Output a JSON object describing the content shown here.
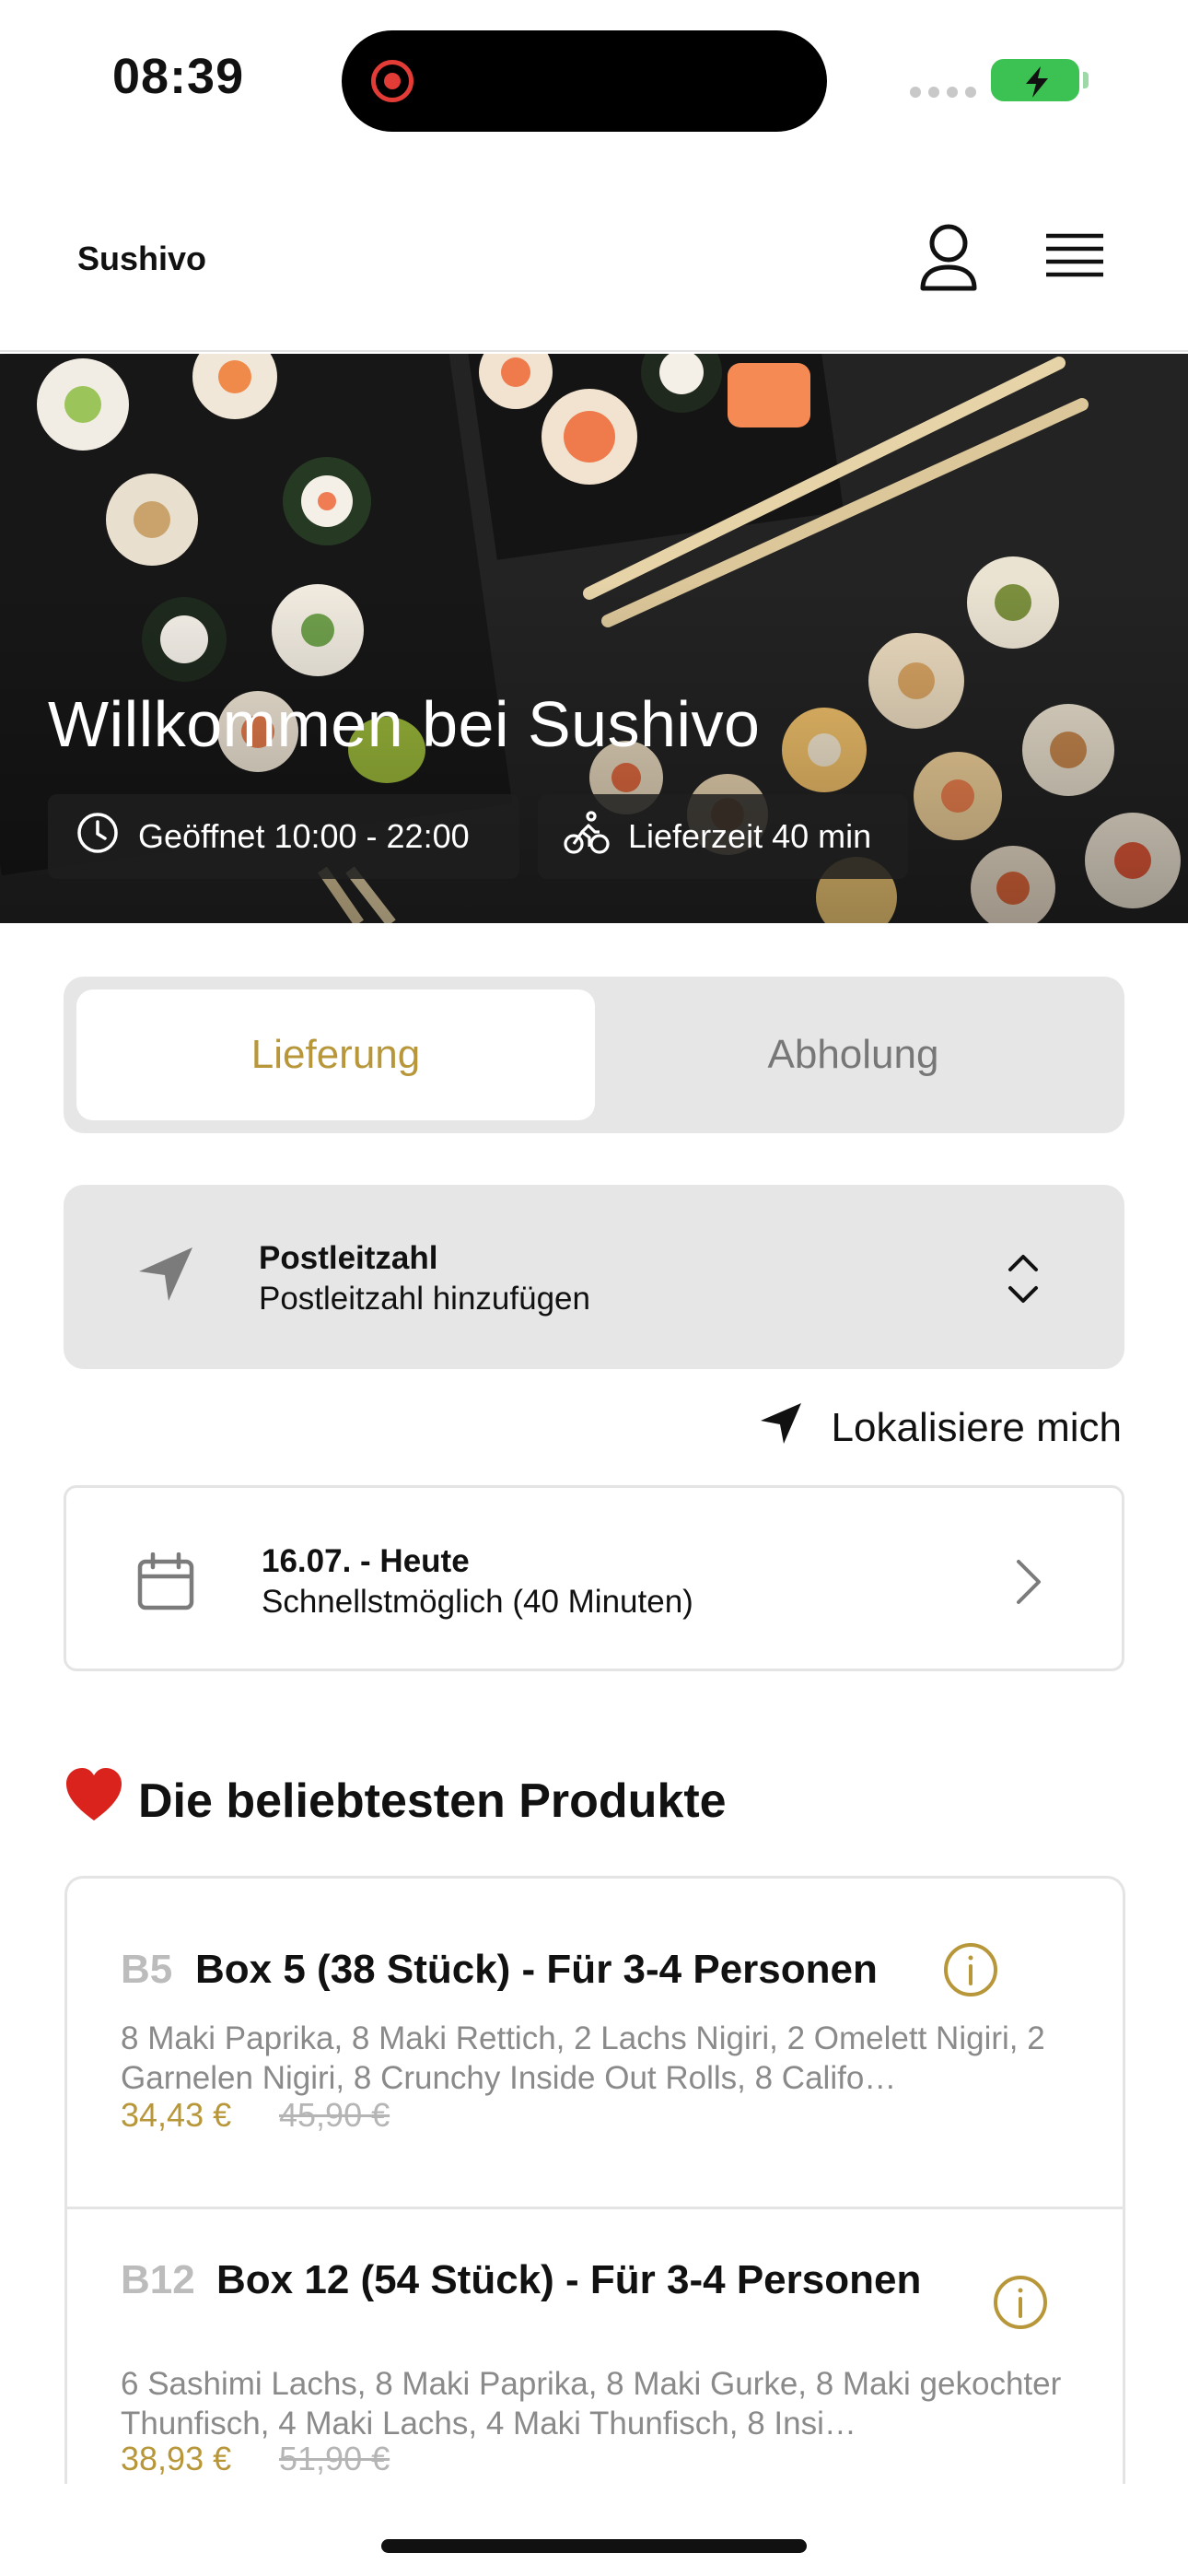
{
  "status_bar": {
    "time": "08:39"
  },
  "header": {
    "brand": "Sushivo"
  },
  "hero": {
    "title": "Willkommen bei Sushivo",
    "hours": "Geöffnet 10:00 - 22:00",
    "delivery_time": "Lieferzeit 40 min"
  },
  "order_mode": {
    "options": [
      "Lieferung",
      "Abholung"
    ],
    "selected": "Lieferung"
  },
  "postal": {
    "title": "Postleitzahl",
    "placeholder": "Postleitzahl hinzufügen"
  },
  "locate_label": "Lokalisiere mich",
  "schedule": {
    "title": "16.07. - Heute",
    "subtitle": "Schnellstmöglich (40 Minuten)"
  },
  "popular": {
    "emoji": "❤️",
    "title": "Die beliebtesten Produkte",
    "items": [
      {
        "code": "B5",
        "name": "Box 5 (38 Stück) - Für 3-4 Personen",
        "description": "8 Maki Paprika, 8 Maki Rettich, 2 Lachs Nigiri, 2 Omelett Nigiri, 2 Garnelen Nigiri, 8 Crunchy Inside Out Rolls, 8 Califo…",
        "price": "34,43 €",
        "old_price": "45,90 €"
      },
      {
        "code": "B12",
        "name": "Box 12 (54  Stück) - Für 3-4 Personen",
        "description": "6 Sashimi Lachs, 8 Maki Paprika, 8 Maki Gurke, 8 Maki gekochter Thunfisch, 4 Maki Lachs, 4 Maki Thunfisch, 8 Insi…",
        "price": "38,93 €",
        "old_price": "51,90 €"
      }
    ]
  },
  "colors": {
    "accent": "#b8973a",
    "segment_bg": "#e6e6e6",
    "recording": "#e33b36",
    "battery": "#3bc252"
  },
  "icons": {
    "user": "user-icon",
    "menu": "menu-icon",
    "clock": "clock-icon",
    "bike": "bicycle-icon",
    "location": "location-arrow-icon",
    "updown": "chevron-up-down-icon",
    "calendar": "calendar-icon",
    "chevron": "chevron-right-icon",
    "info": "info-icon",
    "heart": "heart-emoji"
  }
}
